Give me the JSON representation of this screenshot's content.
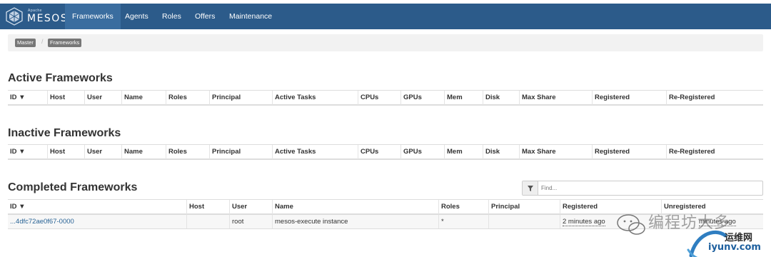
{
  "nav": {
    "brand_small": "Apache",
    "brand_name": "MESOS",
    "items": [
      {
        "label": "Frameworks",
        "active": true
      },
      {
        "label": "Agents"
      },
      {
        "label": "Roles"
      },
      {
        "label": "Offers"
      },
      {
        "label": "Maintenance"
      }
    ]
  },
  "breadcrumb": {
    "items": [
      "Master",
      "Frameworks"
    ],
    "separator": "/"
  },
  "active": {
    "title": "Active Frameworks",
    "columns": [
      "ID ▼",
      "Host",
      "User",
      "Name",
      "Roles",
      "Principal",
      "Active Tasks",
      "CPUs",
      "GPUs",
      "Mem",
      "Disk",
      "Max Share",
      "Registered",
      "Re-Registered"
    ]
  },
  "inactive": {
    "title": "Inactive Frameworks",
    "columns": [
      "ID ▼",
      "Host",
      "User",
      "Name",
      "Roles",
      "Principal",
      "Active Tasks",
      "CPUs",
      "GPUs",
      "Mem",
      "Disk",
      "Max Share",
      "Registered",
      "Re-Registered"
    ]
  },
  "completed": {
    "title": "Completed Frameworks",
    "find_placeholder": "Find...",
    "columns": [
      "ID ▼",
      "Host",
      "User",
      "Name",
      "Roles",
      "Principal",
      "Registered",
      "Unregistered"
    ],
    "rows": [
      {
        "id": "...4dfc72ae0f67-0000",
        "host": "",
        "user": "root",
        "name": "mesos-execute instance",
        "roles": "*",
        "principal": "",
        "registered": "2 minutes ago",
        "unregistered": "minutes ago"
      }
    ]
  },
  "watermark": {
    "line1": "编程坊大多",
    "line2": "运维网",
    "line3": "iyunv.com"
  },
  "colors": {
    "navbar": "#2c5b8a",
    "nav_active": "#3a6d9f",
    "link": "#2a6496"
  },
  "icons": {
    "brand": "mesos-logo-icon",
    "filter": "filter-icon",
    "watermark": "chat-bubble-icon"
  }
}
